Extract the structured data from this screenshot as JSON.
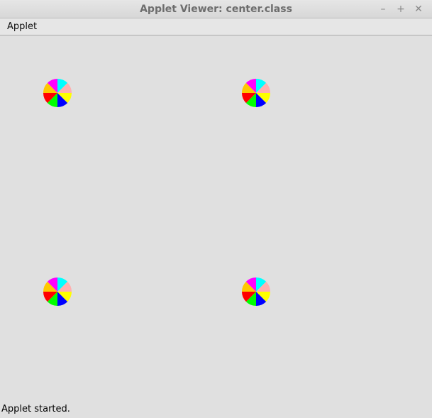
{
  "window": {
    "title": "Applet Viewer: center.class",
    "minimize_glyph": "–",
    "maximize_glyph": "+",
    "close_glyph": "✕"
  },
  "menubar": {
    "items": [
      {
        "label": "Applet"
      }
    ]
  },
  "applet": {
    "wheel_colors": [
      "#00ffff",
      "#ffafaf",
      "#ffff00",
      "#0000ff",
      "#00ff00",
      "#ff0000",
      "#ffc800",
      "#ff00ff"
    ],
    "wheel_count": 4
  },
  "status": {
    "text": "Applet started."
  }
}
